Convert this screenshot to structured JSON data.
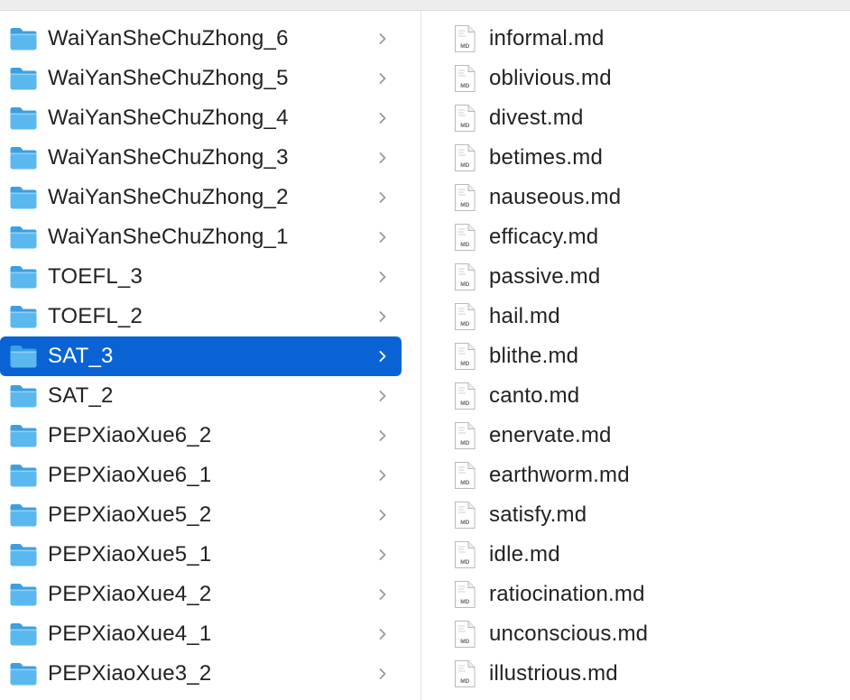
{
  "folders": [
    {
      "label": "WaiYanSheChuZhong_6",
      "selected": false
    },
    {
      "label": "WaiYanSheChuZhong_5",
      "selected": false
    },
    {
      "label": "WaiYanSheChuZhong_4",
      "selected": false
    },
    {
      "label": "WaiYanSheChuZhong_3",
      "selected": false
    },
    {
      "label": "WaiYanSheChuZhong_2",
      "selected": false
    },
    {
      "label": "WaiYanSheChuZhong_1",
      "selected": false
    },
    {
      "label": "TOEFL_3",
      "selected": false
    },
    {
      "label": "TOEFL_2",
      "selected": false
    },
    {
      "label": "SAT_3",
      "selected": true
    },
    {
      "label": "SAT_2",
      "selected": false
    },
    {
      "label": "PEPXiaoXue6_2",
      "selected": false
    },
    {
      "label": "PEPXiaoXue6_1",
      "selected": false
    },
    {
      "label": "PEPXiaoXue5_2",
      "selected": false
    },
    {
      "label": "PEPXiaoXue5_1",
      "selected": false
    },
    {
      "label": "PEPXiaoXue4_2",
      "selected": false
    },
    {
      "label": "PEPXiaoXue4_1",
      "selected": false
    },
    {
      "label": "PEPXiaoXue3_2",
      "selected": false
    }
  ],
  "files": [
    {
      "label": "informal.md",
      "badge": "MD"
    },
    {
      "label": "oblivious.md",
      "badge": "MD"
    },
    {
      "label": "divest.md",
      "badge": "MD"
    },
    {
      "label": "betimes.md",
      "badge": "MD"
    },
    {
      "label": "nauseous.md",
      "badge": "MD"
    },
    {
      "label": "efficacy.md",
      "badge": "MD"
    },
    {
      "label": "passive.md",
      "badge": "MD"
    },
    {
      "label": "hail.md",
      "badge": "MD"
    },
    {
      "label": "blithe.md",
      "badge": "MD"
    },
    {
      "label": "canto.md",
      "badge": "MD"
    },
    {
      "label": "enervate.md",
      "badge": "MD"
    },
    {
      "label": "earthworm.md",
      "badge": "MD"
    },
    {
      "label": "satisfy.md",
      "badge": "MD"
    },
    {
      "label": "idle.md",
      "badge": "MD"
    },
    {
      "label": "ratiocination.md",
      "badge": "MD"
    },
    {
      "label": "unconscious.md",
      "badge": "MD"
    },
    {
      "label": "illustrious.md",
      "badge": "MD"
    }
  ],
  "icons": {
    "folder": "folder-icon",
    "chevron": "chevron-right-icon",
    "file": "markdown-file-icon"
  },
  "colors": {
    "selection": "#0a63d4",
    "folder_body": "#5ab8ef",
    "folder_tab": "#3d9fe0",
    "text": "#222222"
  }
}
